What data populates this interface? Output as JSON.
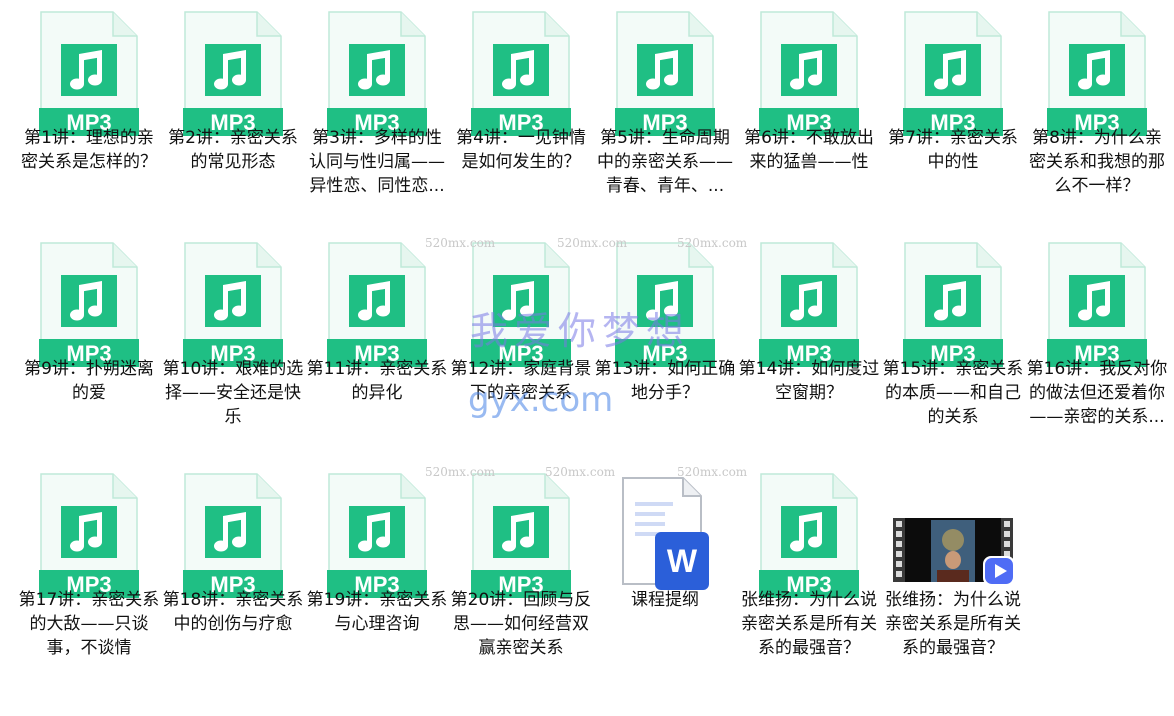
{
  "colors": {
    "mp3_green": "#1fbf84",
    "mp3_page": "#f3fbf8",
    "mp3_border": "#bfe9d9",
    "word_blue": "#2b5fd9"
  },
  "files": [
    {
      "type": "mp3",
      "badge": "MP3",
      "label": "第1讲：理想的亲密关系是怎样的？"
    },
    {
      "type": "mp3",
      "badge": "MP3",
      "label": "第2讲：亲密关系的常见形态"
    },
    {
      "type": "mp3",
      "badge": "MP3",
      "label": "第3讲：多样的性认同与性归属——异性恋、同性恋..."
    },
    {
      "type": "mp3",
      "badge": "MP3",
      "label": "第4讲：一见钟情是如何发生的？"
    },
    {
      "type": "mp3",
      "badge": "MP3",
      "label": "第5讲：生命周期中的亲密关系——青春、青年、..."
    },
    {
      "type": "mp3",
      "badge": "MP3",
      "label": "第6讲：不敢放出来的猛兽——性"
    },
    {
      "type": "mp3",
      "badge": "MP3",
      "label": "第7讲：亲密关系中的性"
    },
    {
      "type": "mp3",
      "badge": "MP3",
      "label": "第8讲：为什么亲密关系和我想的那么不一样？"
    },
    {
      "type": "mp3",
      "badge": "MP3",
      "label": "第9讲：扑朔迷离的爱"
    },
    {
      "type": "mp3",
      "badge": "MP3",
      "label": "第10讲：艰难的选择——安全还是快乐"
    },
    {
      "type": "mp3",
      "badge": "MP3",
      "label": "第11讲：亲密关系的异化"
    },
    {
      "type": "mp3",
      "badge": "MP3",
      "label": "第12讲：家庭背景下的亲密关系"
    },
    {
      "type": "mp3",
      "badge": "MP3",
      "label": "第13讲：如何正确地分手？"
    },
    {
      "type": "mp3",
      "badge": "MP3",
      "label": "第14讲：如何度过空窗期？"
    },
    {
      "type": "mp3",
      "badge": "MP3",
      "label": "第15讲：亲密关系的本质——和自己的关系"
    },
    {
      "type": "mp3",
      "badge": "MP3",
      "label": "第16讲：我反对你的做法但还爱着你——亲密的关系..."
    },
    {
      "type": "mp3",
      "badge": "MP3",
      "label": "第17讲：亲密关系的大敌——只谈事，不谈情"
    },
    {
      "type": "mp3",
      "badge": "MP3",
      "label": "第18讲：亲密关系中的创伤与疗愈"
    },
    {
      "type": "mp3",
      "badge": "MP3",
      "label": "第19讲：亲密关系与心理咨询"
    },
    {
      "type": "mp3",
      "badge": "MP3",
      "label": "第20讲：回顾与反思——如何经营双赢亲密关系"
    },
    {
      "type": "doc",
      "badge": "W",
      "label": "课程提纲"
    },
    {
      "type": "mp3",
      "badge": "MP3",
      "label": "张维扬：为什么说亲密关系是所有关系的最强音？"
    },
    {
      "type": "video",
      "badge": "",
      "label": "张维扬：为什么说亲密关系是所有关系的最强音？"
    }
  ],
  "watermark": {
    "small": "520mx.com",
    "big": "我爱你梦想",
    "url": "gyx.com"
  }
}
